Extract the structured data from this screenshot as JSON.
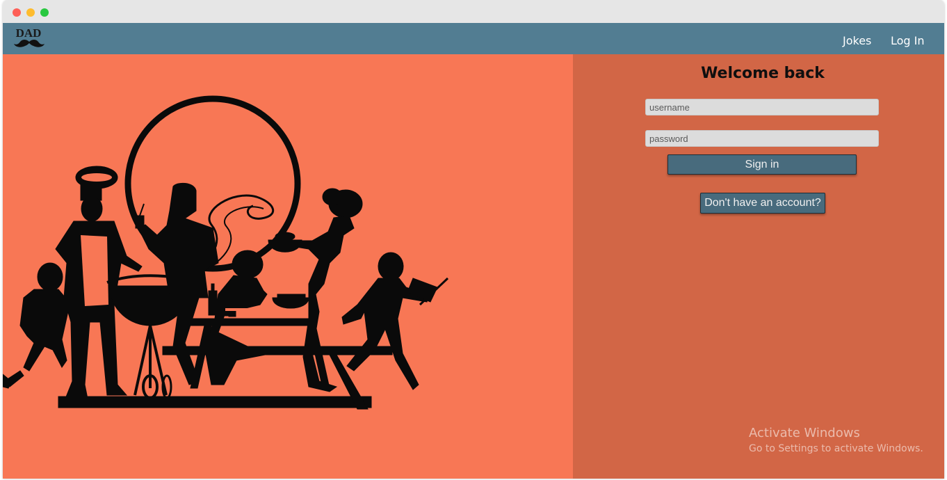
{
  "navbar": {
    "logo_text": "DAD",
    "links": [
      "Jokes",
      "Log In"
    ]
  },
  "login": {
    "heading": "Welcome back",
    "username_placeholder": "username",
    "password_placeholder": "password",
    "signin_label": "Sign in",
    "register_label": "Don't have an account?"
  },
  "watermark": {
    "title": "Activate Windows",
    "subtitle": "Go to Settings to activate Windows."
  },
  "colors": {
    "navbar": "#527d92",
    "left_panel": "#f87755",
    "right_panel": "#d26646",
    "button": "#486b7d"
  },
  "illustration": {
    "icon": "family-bbq-silhouette-illustration"
  }
}
